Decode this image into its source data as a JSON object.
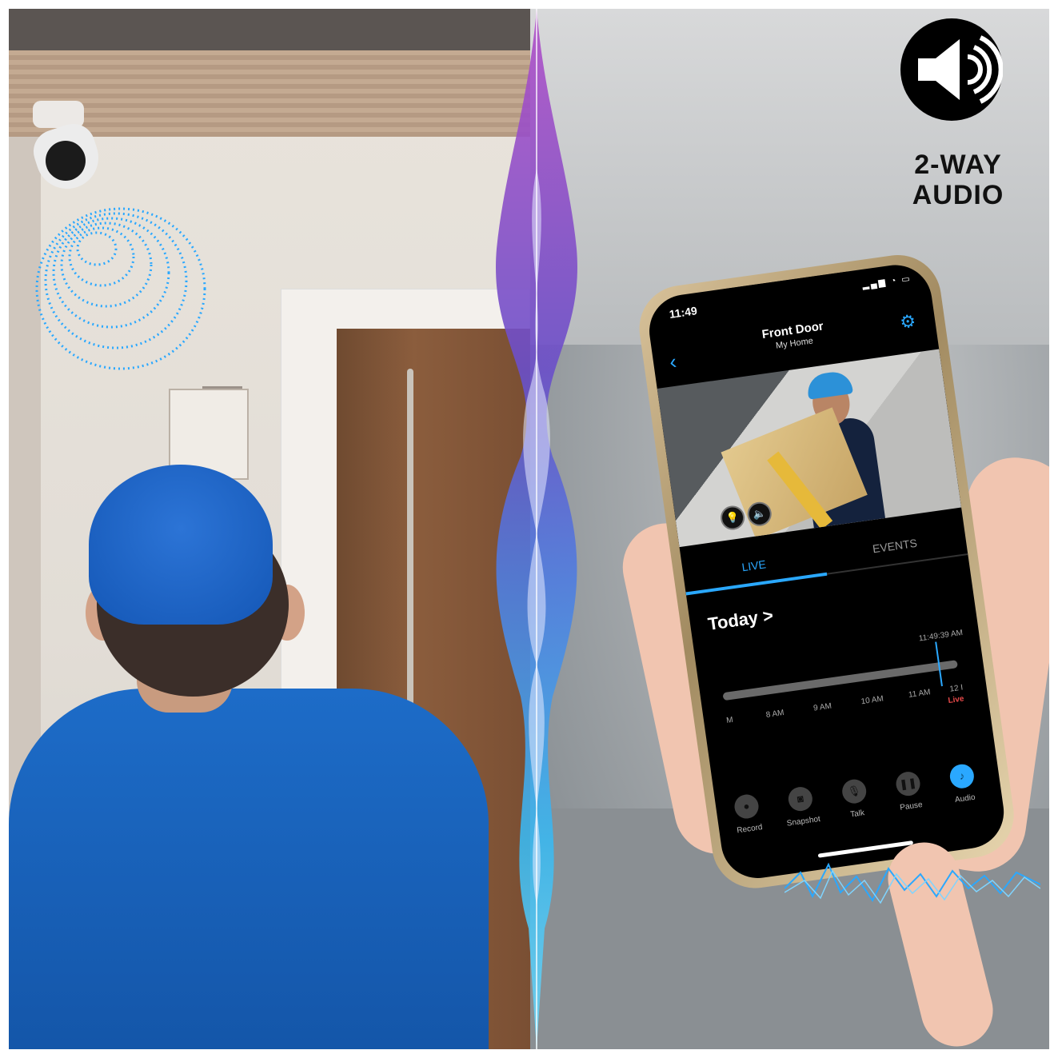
{
  "badge": {
    "icon": "speaker-icon",
    "text_line1": "2-WAY",
    "text_line2": "AUDIO"
  },
  "phone": {
    "status": {
      "time": "11:49"
    },
    "header": {
      "title": "Front Door",
      "subtitle": "My Home",
      "back_icon": "chevron-left-icon",
      "settings_icon": "gear-icon"
    },
    "video_buttons": [
      {
        "icon": "lightbulb-icon"
      },
      {
        "icon": "speaker-icon"
      }
    ],
    "tabs": [
      {
        "label": "LIVE",
        "active": true
      },
      {
        "label": "EVENTS",
        "active": false
      }
    ],
    "timeline": {
      "heading": "Today >",
      "current_time": "11:49:39 AM",
      "ticks": [
        "M",
        "8 AM",
        "9 AM",
        "10 AM",
        "11 AM",
        "12 I"
      ],
      "live_label": "Live"
    },
    "controls": [
      {
        "label": "Record",
        "icon": "record-icon",
        "active": false
      },
      {
        "label": "Snapshot",
        "icon": "camera-icon",
        "active": false
      },
      {
        "label": "Talk",
        "icon": "microphone-icon",
        "active": false
      },
      {
        "label": "Pause",
        "icon": "pause-icon",
        "active": false
      },
      {
        "label": "Audio",
        "icon": "audio-icon",
        "active": true
      }
    ]
  },
  "colors": {
    "accent": "#2aa8ff",
    "live_red": "#e84a4a",
    "shirt_blue": "#1d6cc8"
  }
}
